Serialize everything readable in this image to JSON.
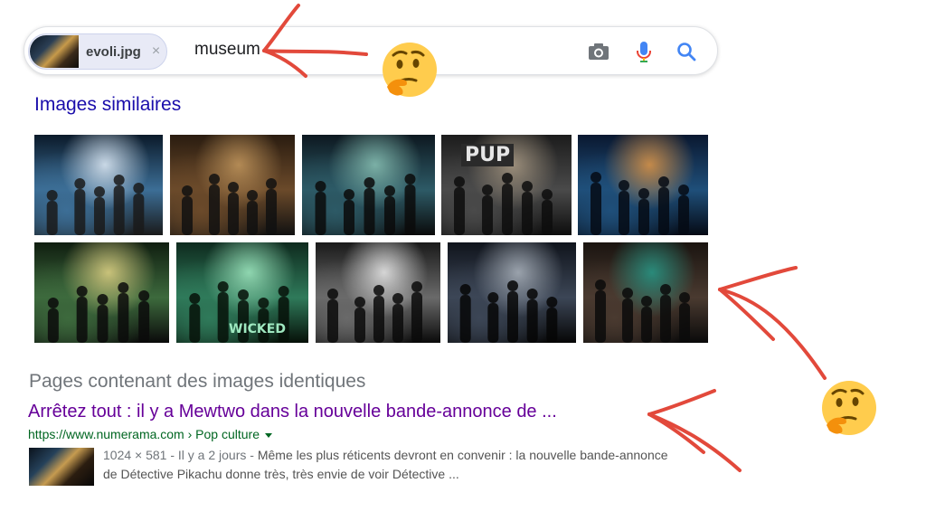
{
  "search": {
    "image_chip": {
      "filename": "evoli.jpg",
      "close_label": "×"
    },
    "query": "museum",
    "icons": [
      "camera-icon",
      "microphone-icon",
      "search-icon"
    ]
  },
  "similar": {
    "title": "Images similaires",
    "rows": [
      [
        {
          "caption": "",
          "palette": [
            "#0b1a2a",
            "#3c6e96",
            "#c9d8e6",
            "#1a1a1a"
          ]
        },
        {
          "caption": "",
          "palette": [
            "#2a1c10",
            "#6b4a2a",
            "#b38a55",
            "#111111"
          ]
        },
        {
          "caption": "",
          "palette": [
            "#0d1820",
            "#2d5a66",
            "#7bb0a6",
            "#0a0a0a"
          ]
        },
        {
          "caption": "PUP",
          "palette": [
            "#1c1c1c",
            "#4a4a4a",
            "#9a8d7a",
            "#0d0d0d"
          ]
        },
        {
          "caption": "",
          "palette": [
            "#0a1830",
            "#1f4f7a",
            "#c48a4a",
            "#050a14"
          ]
        }
      ],
      [
        {
          "caption": "",
          "palette": [
            "#101e10",
            "#3d6a3d",
            "#c9c27a",
            "#0a0a0a"
          ]
        },
        {
          "caption": "WICKED",
          "palette": [
            "#0e2a1e",
            "#2f7a5a",
            "#8fd6b0",
            "#061008"
          ]
        },
        {
          "caption": "",
          "palette": [
            "#1a1a1a",
            "#6a6a6a",
            "#d6d6d6",
            "#0a0a0a"
          ]
        },
        {
          "caption": "",
          "palette": [
            "#10141c",
            "#3c4656",
            "#9aa2ac",
            "#060606"
          ]
        },
        {
          "caption": "",
          "palette": [
            "#1a1410",
            "#4a3a30",
            "#2a8a7a",
            "#0a0a0a"
          ]
        }
      ]
    ]
  },
  "identical": {
    "title": "Pages contenant des images identiques",
    "result": {
      "title": "Arrêtez tout : il y a Mewtwo dans la nouvelle bande-annonce de ...",
      "url": "https://www.numerama.com › Pop culture",
      "meta": "1024 × 581 - Il y a 2 jours - ",
      "snippet": "Même les plus réticents devront en convenir : la nouvelle bande-annonce de Détective Pikachu donne très, très envie de voir Détective ..."
    }
  },
  "annotations": {
    "arrow_color": "#e2493b",
    "emoji": "🤔"
  }
}
